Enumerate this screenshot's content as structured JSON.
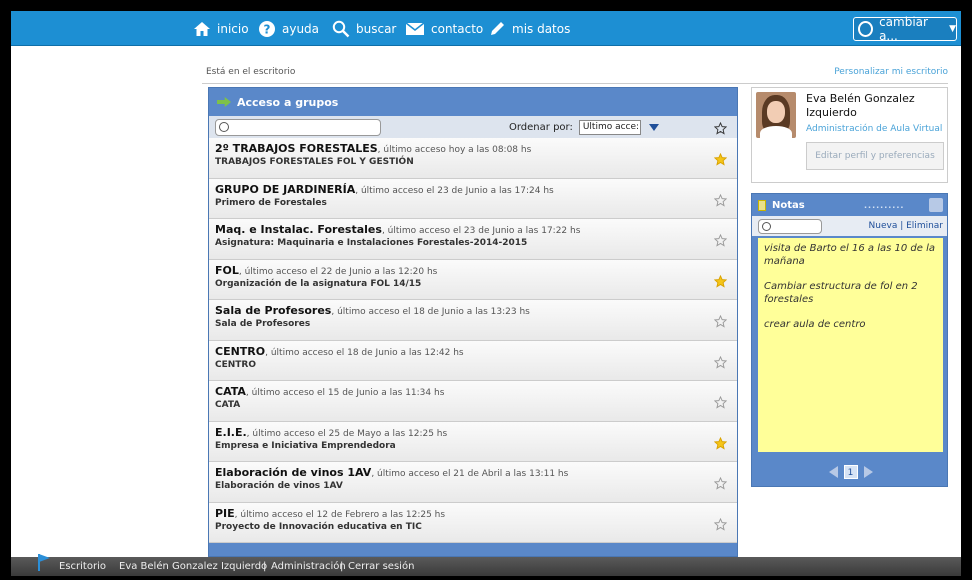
{
  "nav": {
    "inicio": "inicio",
    "ayuda": "ayuda",
    "buscar": "buscar",
    "contacto": "contacto",
    "mis_datos": "mis datos",
    "cambiar": "cambiar a..."
  },
  "breadcrumb": "Está en el escritorio",
  "customize": "Personalizar mi escritorio",
  "groups": {
    "title": "Acceso a grupos",
    "order_label": "Ordenar por:",
    "order_value": "Ultimo acce:",
    "items": [
      {
        "name": "2º TRABAJOS FORESTALES",
        "access": ", último acceso hoy a las 08:08 hs",
        "subtitle": "TRABAJOS FORESTALES FOL Y GESTIÓN",
        "starred": true
      },
      {
        "name": "GRUPO DE JARDINERÍA",
        "access": ", último acceso el 23 de Junio a las 17:24 hs",
        "subtitle": "Primero de Forestales",
        "starred": false
      },
      {
        "name": "Maq. e Instalac. Forestales",
        "access": ", último acceso el 23 de Junio a las 17:22 hs",
        "subtitle": "Asignatura: Maquinaria e Instalaciones Forestales-2014-2015",
        "starred": false
      },
      {
        "name": "FOL",
        "access": ", último acceso el 22 de Junio a las 12:20 hs",
        "subtitle": "Organización de la asignatura FOL 14/15",
        "starred": true
      },
      {
        "name": "Sala de Profesores",
        "access": ", último acceso el 18 de Junio a las 13:23 hs",
        "subtitle": "Sala de Profesores",
        "starred": false
      },
      {
        "name": "CENTRO",
        "access": ", último acceso el 18 de Junio a las 12:42 hs",
        "subtitle": "CENTRO",
        "starred": false
      },
      {
        "name": "CATA",
        "access": ", último acceso el 15 de Junio a las 11:34 hs",
        "subtitle": "CATA",
        "starred": false
      },
      {
        "name": "E.I.E.",
        "access": ", último acceso el 25 de Mayo a las 12:25 hs",
        "subtitle": "Empresa e Iniciativa Emprendedora",
        "starred": true
      },
      {
        "name": "Elaboración de vinos 1AV",
        "access": ", último acceso el 21 de Abril a las 13:11 hs",
        "subtitle": "Elaboración de vinos 1AV",
        "starred": false
      },
      {
        "name": "PIE",
        "access": ", último acceso el 12 de Febrero a las 12:25 hs",
        "subtitle": "Proyecto de Innovación educativa en TIC",
        "starred": false
      }
    ]
  },
  "profile": {
    "name": "Eva Belén Gonzalez Izquierdo",
    "role": "Administración de Aula Virtual",
    "edit": "Editar perfil y preferencias"
  },
  "notes": {
    "title": "Notas",
    "new": "Nueva",
    "delete": "Eliminar",
    "lines": [
      "visita de Barto el 16 a las 10 de la mañana",
      "Cambiar estructura de fol en 2 forestales",
      "crear aula de centro"
    ],
    "page": "1"
  },
  "footer": {
    "escritorio": "Escritorio",
    "user": "Eva Belén Gonzalez Izquierdo",
    "admin": "Administración",
    "logout": "Cerrar sesión"
  },
  "colors": {
    "accent": "#1d8fd3",
    "panel": "#5a88c9",
    "star_on": "#f5c518"
  }
}
